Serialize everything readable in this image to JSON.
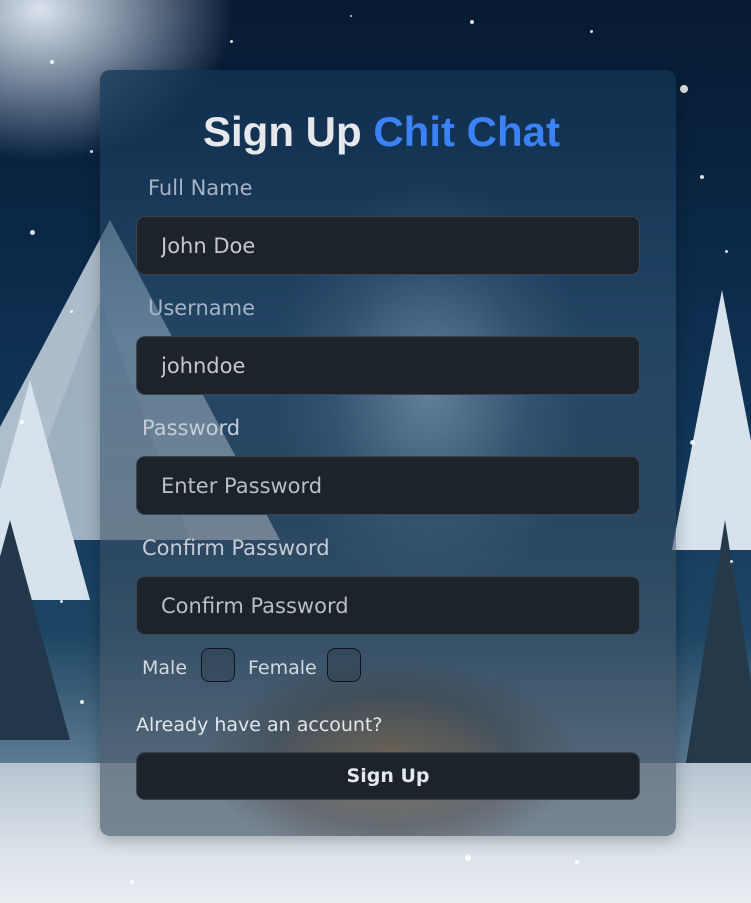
{
  "form": {
    "title_main": "Sign Up",
    "title_accent": "Chit Chat",
    "full_name": {
      "label": "Full Name",
      "value": "John Doe"
    },
    "username": {
      "label": "Username",
      "value": "johndoe"
    },
    "password": {
      "label": "Password",
      "placeholder": "Enter Password"
    },
    "confirm_password": {
      "label": "Confirm Password",
      "placeholder": "Confirm Password"
    },
    "gender": {
      "male_label": "Male",
      "female_label": "Female",
      "male_checked": false,
      "female_checked": false
    },
    "login_link": "Already have an account?",
    "submit_label": "Sign Up"
  },
  "colors": {
    "accent": "#3b82f6",
    "input_bg": "#1d232b",
    "text": "#e6e8ec"
  }
}
